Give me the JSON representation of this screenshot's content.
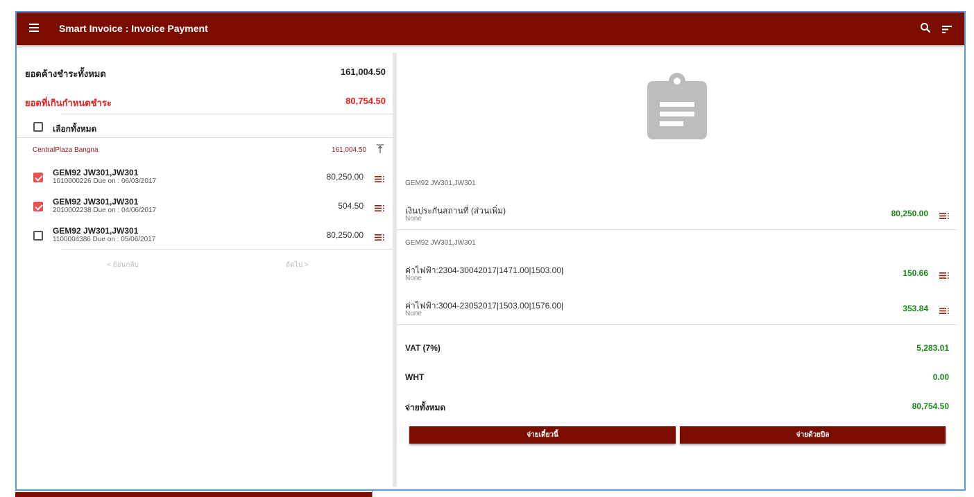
{
  "appbar": {
    "title": "Smart Invoice : Invoice Payment",
    "menu_icon": "hamburger-menu-icon",
    "search_icon": "search-icon",
    "sort_icon": "sort-icon",
    "color": "#7b0c00"
  },
  "summary": {
    "outstanding_label": "ยอดค้างชำระทั้งหมด",
    "outstanding_value": "161,004.50",
    "overdue_label": "ยอดที่เกินกำหนดชำระ",
    "overdue_value": "80,754.50"
  },
  "select_all_label": "เลือกทั้งหมด",
  "group": {
    "name": "CentralPlaza Bangna",
    "total": "161,004.50"
  },
  "invoices": [
    {
      "name": "GEM92 JW301,JW301",
      "sub": "1010000226 Due on : 06/03/2017",
      "amount": "80,250.00",
      "checked": true
    },
    {
      "name": "GEM92 JW301,JW301",
      "sub": "2010002238 Due on : 04/06/2017",
      "amount": "504.50",
      "checked": true
    },
    {
      "name": "GEM92 JW301,JW301",
      "sub": "1100004386 Due on : 05/06/2017",
      "amount": "80,250.00",
      "checked": false
    }
  ],
  "pager": {
    "prev": "< ย้อนกลับ",
    "next": "ถัดไป >"
  },
  "detail": {
    "groups": [
      {
        "label": "GEM92 JW301,JW301",
        "items": [
          {
            "name": "เงินประกันสถานที่ (ส่วนเพิ่ม)",
            "sub": "None",
            "amount": "80,250.00"
          }
        ]
      },
      {
        "label": "GEM92 JW301,JW301",
        "items": [
          {
            "name": "ค่าไฟฟ้า:2304-30042017|1471.00|1503.00|",
            "sub": "None",
            "amount": "150.66"
          },
          {
            "name": "ค่าไฟฟ้า:3004-23052017|1503.00|1576.00|",
            "sub": "None",
            "amount": "353.84"
          }
        ]
      }
    ],
    "vat_label": "VAT (7%)",
    "vat_value": "5,283.01",
    "wht_label": "WHT",
    "wht_value": "0.00",
    "total_label": "จ่ายทั้งหมด",
    "total_value": "80,754.50",
    "pay_now_label": "จ่ายเดี๋ยวนี้",
    "pay_bill_label": "จ่ายด้วยบิล"
  }
}
